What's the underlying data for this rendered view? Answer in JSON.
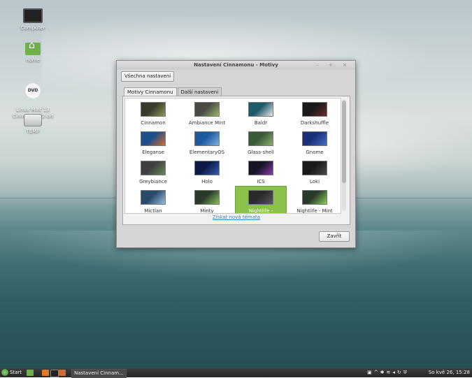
{
  "desktop": {
    "icons": [
      {
        "label": "Computer",
        "icon": "computer-icon"
      },
      {
        "label": "home",
        "icon": "home-folder-icon"
      },
      {
        "label": "Linux Mint 13\nCinnamon 32-bit",
        "icon": "dvd-icon",
        "badge": "DVD"
      },
      {
        "label": "TEMP",
        "icon": "drive-icon"
      }
    ]
  },
  "window": {
    "title": "Nastavení Cinnamonu - Motivy",
    "controls": "– + ×",
    "all_settings_label": "Všechna nastavení",
    "tabs": [
      {
        "label": "Motivy Cinnamonu",
        "active": true
      },
      {
        "label": "Další nastavení",
        "active": false
      }
    ],
    "themes": [
      {
        "name": "Cinnamon",
        "colors": [
          "#3a3a2a",
          "#8a9a5a"
        ]
      },
      {
        "name": "Ambiance Mint",
        "colors": [
          "#4a4a44",
          "#9ab86a"
        ]
      },
      {
        "name": "Baldr",
        "colors": [
          "#1e5a6a",
          "#eaeaea"
        ]
      },
      {
        "name": "Darkshuffle",
        "colors": [
          "#1a1a1a",
          "#6a2a2a"
        ]
      },
      {
        "name": "Eleganse",
        "colors": [
          "#1f4f8a",
          "#d46a2a"
        ]
      },
      {
        "name": "ElementaryOS",
        "colors": [
          "#1c5aa0",
          "#7fb0dd"
        ]
      },
      {
        "name": "Glass-shell",
        "colors": [
          "#3a5a3a",
          "#8ab06a"
        ]
      },
      {
        "name": "Gnome",
        "colors": [
          "#1a2f7a",
          "#4a70c0"
        ]
      },
      {
        "name": "Greybiance",
        "colors": [
          "#3f3f3f",
          "#6a8a5a"
        ]
      },
      {
        "name": "Holo",
        "colors": [
          "#0c1a4a",
          "#3a60b0"
        ]
      },
      {
        "name": "ICS",
        "colors": [
          "#151525",
          "#8a3ab0"
        ]
      },
      {
        "name": "Loki",
        "colors": [
          "#1a1a1a",
          "#4a4a4a"
        ]
      },
      {
        "name": "Mictlan",
        "colors": [
          "#2a4a6a",
          "#9ac0e0"
        ]
      },
      {
        "name": "Minty",
        "colors": [
          "#2a3a2a",
          "#8ac060"
        ]
      },
      {
        "name": "Nightlife -",
        "colors": [
          "#2a2a2a",
          "#5a5a5a"
        ],
        "selected": true
      },
      {
        "name": "Nightlife - Mint",
        "colors": [
          "#2a3a2a",
          "#8ad05a"
        ]
      }
    ],
    "get_more_link": "Získat nová témata",
    "close_label": "Zavřít"
  },
  "taskbar": {
    "start_label": "Start",
    "task_label": "Nastavení Cinnam...",
    "clock": "So kvě 26, 15:28"
  }
}
